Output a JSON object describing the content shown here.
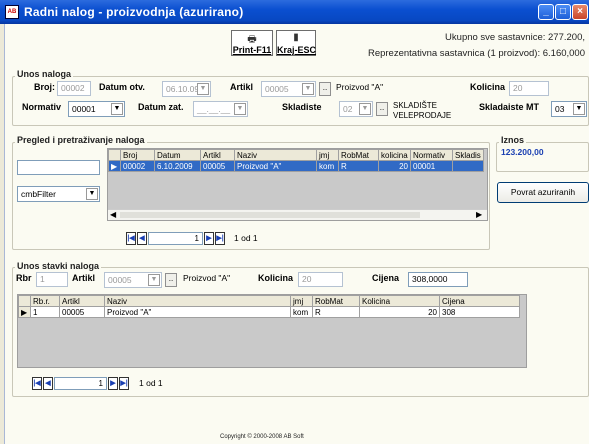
{
  "window": {
    "title": "Radni nalog - proizvodnja (azurirano)",
    "app_badge": "AB"
  },
  "toolbar": {
    "print_label": "Print-F11",
    "exit_label": "Kraj-ESC"
  },
  "summary": {
    "total": "Ukupno sve sastavnice: 277.200,",
    "representative": "Reprezentativna sastavnica (1 proizvod): 6.160,000"
  },
  "unos_naloga": {
    "group_label": "Unos naloga",
    "broj_label": "Broj:",
    "broj_value": "00002",
    "datum_otv_label": "Datum otv.",
    "datum_otv_value": "06.10.09",
    "artikl_label": "Artikl",
    "artikl_value": "00005",
    "artikl_name": "Proizvod \"A\"",
    "kolicina_label": "Kolicina",
    "kolicina_value": "20",
    "normativ_label": "Normativ",
    "normativ_value": "00001",
    "datum_zat_label": "Datum zat.",
    "datum_zat_value": "__.__.__",
    "skladiste_label": "Skladiste",
    "skladiste_value": "02",
    "skladiste_name_1": "SKLADIŠTE",
    "skladiste_name_2": "VELEPRODAJE",
    "skladiste_mt_label": "Skladaiste MT",
    "skladiste_mt_value": "03"
  },
  "pregled": {
    "group_label": "Pregled i pretraživanje naloga",
    "search_value": "",
    "filter_value": "cmbFilter",
    "columns": [
      "Broj",
      "Datum",
      "Artikl",
      "Naziv",
      "jmj",
      "RobMat",
      "kolicina",
      "Normativ",
      "Skladis"
    ],
    "rows": [
      [
        "00002",
        "6.10.2009",
        "00005",
        "Proizvod \"A\"",
        "kom",
        "R",
        "20",
        "00001",
        ""
      ]
    ],
    "nav_position": "1",
    "nav_total": "1 od 1",
    "iznos_label": "Iznos",
    "iznos_value": "123.200,00",
    "povrat_button": "Povrat azuriranih"
  },
  "stavke": {
    "group_label": "Unos stavki naloga",
    "rbr_label": "Rbr",
    "rbr_value": "1",
    "artikl_label": "Artikl",
    "artikl_value": "00005",
    "artikl_name": "Proizvod \"A\"",
    "kolicina_label": "Kolicina",
    "kolicina_value": "20",
    "cijena_label": "Cijena",
    "cijena_value": "308,0000",
    "columns": [
      "Rb.r.",
      "Artikl",
      "Naziv",
      "jmj",
      "RobMat",
      "Kolicina",
      "Cijena"
    ],
    "rows": [
      [
        "1",
        "00005",
        "Proizvod \"A\"",
        "kom",
        "R",
        "20",
        "308"
      ]
    ],
    "nav_position": "1",
    "nav_total": "1 od 1"
  },
  "footer": {
    "copyright": "Copyright © 2000-2008 AB Soft"
  },
  "colors": {
    "title_bar": "#0a4fd0",
    "selection": "#316ac5",
    "iznos_text": "#1a3fb2"
  }
}
